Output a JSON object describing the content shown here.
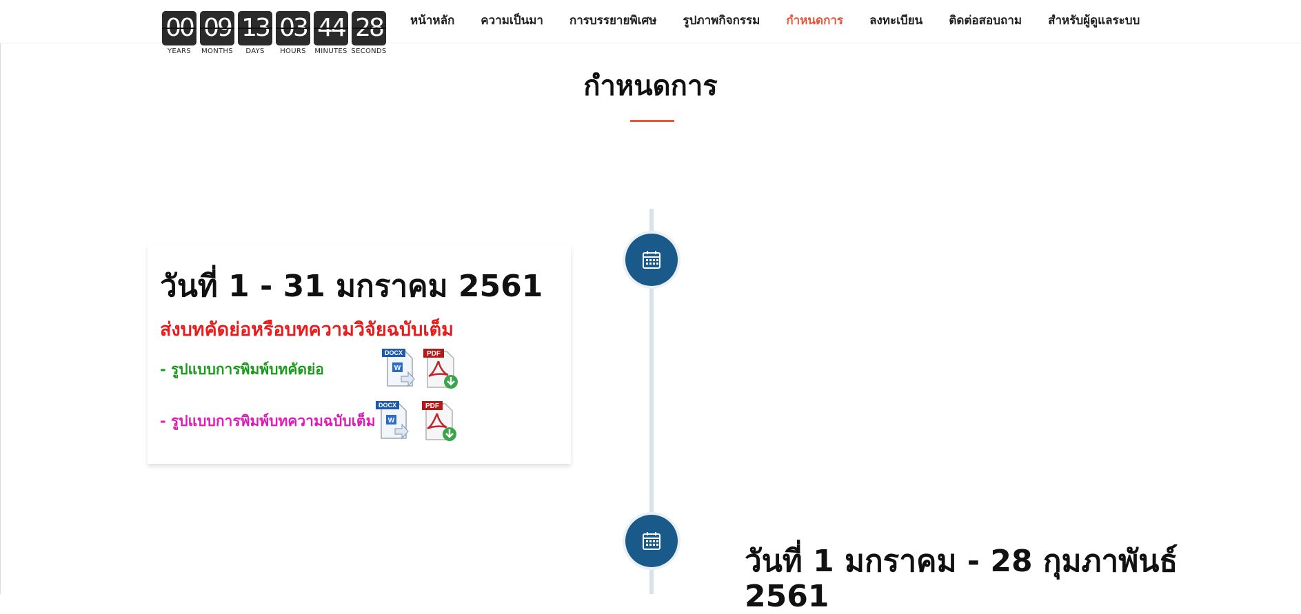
{
  "countdown": [
    {
      "value": "00",
      "label": "YEARS"
    },
    {
      "value": "09",
      "label": "MONTHS"
    },
    {
      "value": "13",
      "label": "DAYS"
    },
    {
      "value": "03",
      "label": "HOURS"
    },
    {
      "value": "44",
      "label": "MINUTES"
    },
    {
      "value": "28",
      "label": "SECONDS"
    }
  ],
  "nav": [
    {
      "label": "หน้าหลัก"
    },
    {
      "label": "ความเป็นมา"
    },
    {
      "label": "การบรรยายพิเศษ"
    },
    {
      "label": "รูปภาพกิจกรรม"
    },
    {
      "label": "กำหนดการ",
      "active": true
    },
    {
      "label": "ลงทะเบียน"
    },
    {
      "label": "ติดต่อสอบถาม"
    },
    {
      "label": "สำหรับผู้ดูแลระบบ"
    }
  ],
  "page": {
    "title": "กำหนดการ"
  },
  "timeline": {
    "item1": {
      "date": "วันที่ 1 - 31 มกราคม 2561",
      "heading": "ส่งบทคัดย่อหรือบทความวิจัยฉบับเต็ม",
      "link_abstract": "- รูปแบบการพิมพ์บทคัดย่อ",
      "link_fullpaper": "- รูปแบบการพิมพ์บทความฉบับเต็ม",
      "docx_badge": "DOCX",
      "pdf_badge": "PDF"
    },
    "item2": {
      "date": "วันที่ 1 มกราคม - 28 กุมภาพันธ์ 2561"
    }
  },
  "colors": {
    "accent": "#e8563a",
    "timeline_dot": "#1a5a8a",
    "heading_red": "#e81c1c",
    "link_green": "#1a9a1a",
    "link_magenta": "#e01ab8"
  },
  "icons": {
    "timeline": "calendar-icon",
    "doc": "docx-file-icon",
    "pdf": "pdf-download-icon"
  }
}
